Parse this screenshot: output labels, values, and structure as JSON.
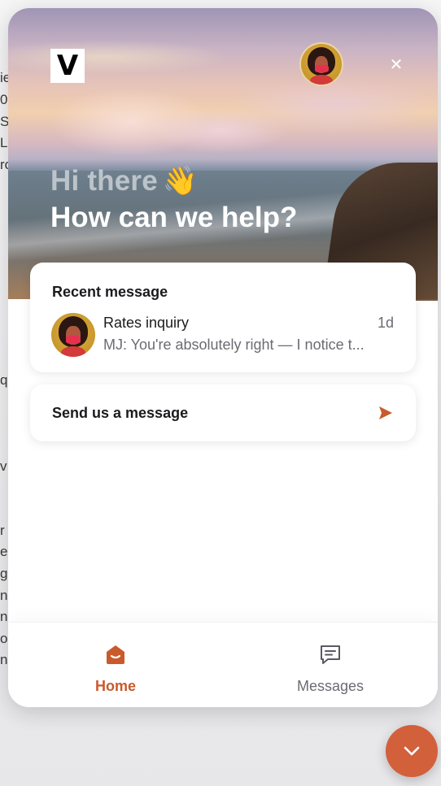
{
  "background_page": {
    "fragments": [
      "ie",
      "0",
      "S",
      "Liv",
      "ro",
      "q",
      "v",
      "r",
      "e",
      "g",
      "nd",
      "ng",
      "or",
      "na"
    ]
  },
  "widget": {
    "logo_letter": "V",
    "greeting": "Hi there",
    "greeting_emoji": "👋",
    "headline": "How can we help?",
    "recent": {
      "title": "Recent message",
      "subject": "Rates inquiry",
      "time": "1d",
      "preview": "MJ: You're absolutely right — I notice t..."
    },
    "send": {
      "label": "Send us a message"
    },
    "nav": {
      "home_label": "Home",
      "messages_label": "Messages"
    }
  },
  "colors": {
    "accent": "#c95a2c",
    "launcher": "#d2603a",
    "muted_text": "#6b6b73",
    "primary_text": "#1b1b1f"
  },
  "icons": {
    "close": "close-icon",
    "send": "send-arrow-icon",
    "home": "home-icon",
    "messages": "messages-icon",
    "launcher": "chevron-down-icon"
  }
}
